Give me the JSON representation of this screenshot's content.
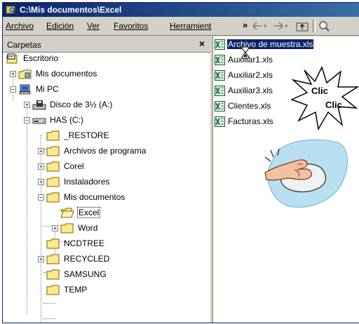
{
  "window": {
    "title": "C:\\Mis documentos\\Excel"
  },
  "menu": {
    "items": [
      "Archivo",
      "Edición",
      "Ver",
      "Favoritos",
      "Herramient"
    ],
    "more": "»"
  },
  "folders_panel": {
    "title": "Carpetas",
    "close": "×",
    "tree": [
      {
        "label": "Escritorio"
      },
      {
        "label": "Mis documentos"
      },
      {
        "label": "Mi PC"
      },
      {
        "label": "Disco de 3½ (A:)"
      },
      {
        "label": "HAS (C:)"
      },
      {
        "label": "_RESTORE"
      },
      {
        "label": "Archivos de programa"
      },
      {
        "label": "Corel"
      },
      {
        "label": "Instaladores"
      },
      {
        "label": "Mis documentos"
      },
      {
        "label": "Excel"
      },
      {
        "label": "Word"
      },
      {
        "label": "NCDTREE"
      },
      {
        "label": "RECYCLED"
      },
      {
        "label": "SAMSUNG"
      },
      {
        "label": "TEMP"
      }
    ]
  },
  "files": [
    {
      "name": "Archivo de muestra.xls"
    },
    {
      "name": "Auxiliar1.xls"
    },
    {
      "name": "Auxiliar2.xls"
    },
    {
      "name": "Auxiliar3.xls"
    },
    {
      "name": "Clientes.xls"
    },
    {
      "name": "Facturas.xls"
    }
  ],
  "callout": {
    "line1": "Clic",
    "line2": "Clic"
  },
  "colors": {
    "title_bar": "#0a246a",
    "selection": "#0a246a",
    "folder": "#ffe98a",
    "excel": "#1f7a3a"
  }
}
